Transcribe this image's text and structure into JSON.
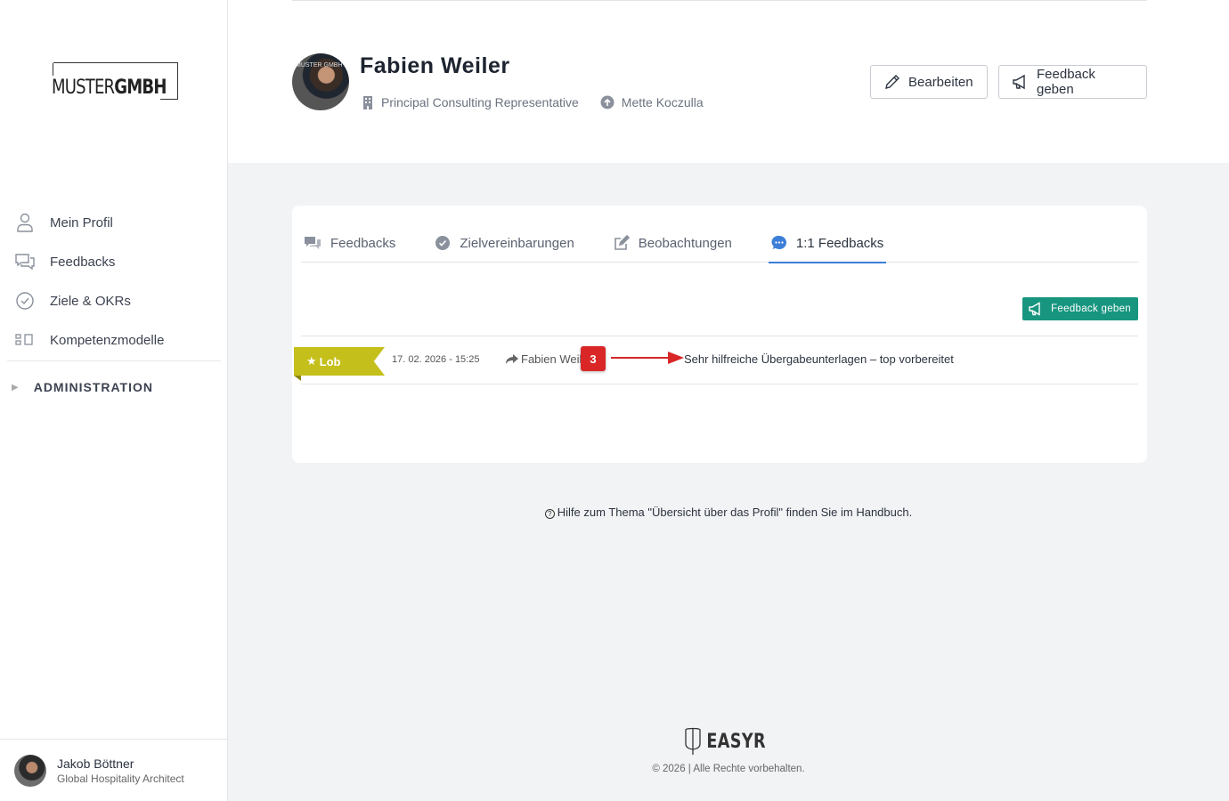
{
  "sidebar": {
    "logo_text_light": "MUSTER",
    "logo_text_bold": "GMBH",
    "items": [
      {
        "label": "Mein Profil",
        "icon": "user-icon"
      },
      {
        "label": "Feedbacks",
        "icon": "chat-bubbles-icon"
      },
      {
        "label": "Ziele & OKRs",
        "icon": "check-circle-icon"
      },
      {
        "label": "Kompetenzmodelle",
        "icon": "competence-icon"
      }
    ],
    "admin_label": "ADMINISTRATION",
    "user": {
      "name": "Jakob Böttner",
      "role": "Global Hospitality Architect"
    }
  },
  "profile": {
    "avatar_logo": "MUSTER GMBH",
    "name": "Fabien Weiler",
    "position": "Principal Consulting Representative",
    "manager": "Mette Koczulla",
    "edit_label": "Bearbeiten",
    "feedback_label": "Feedback geben"
  },
  "tabs": [
    {
      "label": "Feedbacks",
      "icon": "chat-bubbles-icon"
    },
    {
      "label": "Zielvereinbarungen",
      "icon": "check-circle-icon"
    },
    {
      "label": "Beobachtungen",
      "icon": "edit-icon"
    },
    {
      "label": "1:1 Feedbacks",
      "icon": "chat-dots-icon",
      "active": true
    }
  ],
  "feedback_button": "Feedback geben",
  "feedback_row": {
    "type": "Lob",
    "date": "17. 02. 2026 - 15:25",
    "from": "Fabien Weil",
    "badge": "3",
    "message": "Sehr hilfreiche Übergabeunterlagen – top vorbereitet"
  },
  "help_text": "Hilfe zum Thema \"Übersicht über das Profil\" finden Sie im Handbuch.",
  "footer": {
    "brand": "EASYR",
    "copyright": "© 2026 | Alle Rechte vorbehalten."
  },
  "colors": {
    "accent": "#3d7fd8",
    "primary_green": "#17957f",
    "lob_ribbon": "#c5bf1b",
    "badge_red": "#d92727"
  }
}
